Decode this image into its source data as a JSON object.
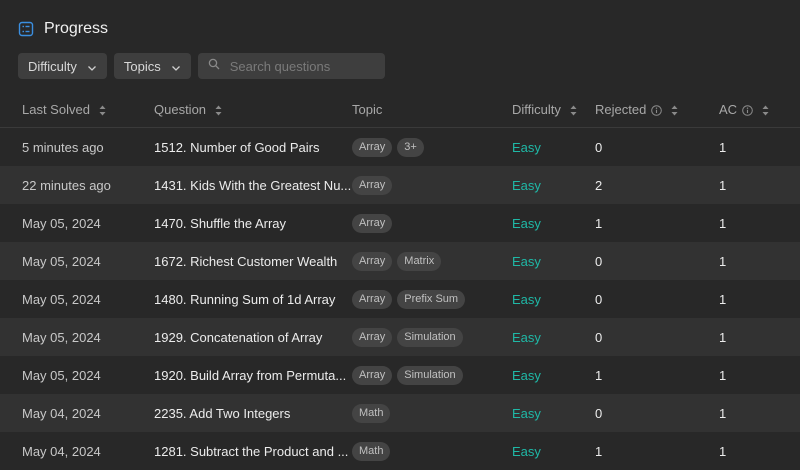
{
  "header": {
    "title": "Progress",
    "icon": "progress-list-icon"
  },
  "filters": {
    "difficulty_label": "Difficulty",
    "topics_label": "Topics",
    "search_placeholder": "Search questions"
  },
  "columns": {
    "last_solved": "Last Solved",
    "question": "Question",
    "topic": "Topic",
    "difficulty": "Difficulty",
    "rejected": "Rejected",
    "ac": "AC"
  },
  "colors": {
    "easy": "#1fb8a6",
    "accent_icon": "#3b8fe0"
  },
  "rows": [
    {
      "date": "5 minutes ago",
      "question": "1512. Number of Good Pairs",
      "tags": [
        "Array",
        "3+"
      ],
      "difficulty": "Easy",
      "rejected": "0",
      "ac": "1"
    },
    {
      "date": "22 minutes ago",
      "question": "1431. Kids With the Greatest Nu...",
      "tags": [
        "Array"
      ],
      "difficulty": "Easy",
      "rejected": "2",
      "ac": "1"
    },
    {
      "date": "May 05, 2024",
      "question": "1470. Shuffle the Array",
      "tags": [
        "Array"
      ],
      "difficulty": "Easy",
      "rejected": "1",
      "ac": "1"
    },
    {
      "date": "May 05, 2024",
      "question": "1672. Richest Customer Wealth",
      "tags": [
        "Array",
        "Matrix"
      ],
      "difficulty": "Easy",
      "rejected": "0",
      "ac": "1"
    },
    {
      "date": "May 05, 2024",
      "question": "1480. Running Sum of 1d Array",
      "tags": [
        "Array",
        "Prefix Sum"
      ],
      "difficulty": "Easy",
      "rejected": "0",
      "ac": "1"
    },
    {
      "date": "May 05, 2024",
      "question": "1929. Concatenation of Array",
      "tags": [
        "Array",
        "Simulation"
      ],
      "difficulty": "Easy",
      "rejected": "0",
      "ac": "1"
    },
    {
      "date": "May 05, 2024",
      "question": "1920. Build Array from Permuta...",
      "tags": [
        "Array",
        "Simulation"
      ],
      "difficulty": "Easy",
      "rejected": "1",
      "ac": "1"
    },
    {
      "date": "May 04, 2024",
      "question": "2235. Add Two Integers",
      "tags": [
        "Math"
      ],
      "difficulty": "Easy",
      "rejected": "0",
      "ac": "1"
    },
    {
      "date": "May 04, 2024",
      "question": "1281. Subtract the Product and ...",
      "tags": [
        "Math"
      ],
      "difficulty": "Easy",
      "rejected": "1",
      "ac": "1"
    }
  ]
}
